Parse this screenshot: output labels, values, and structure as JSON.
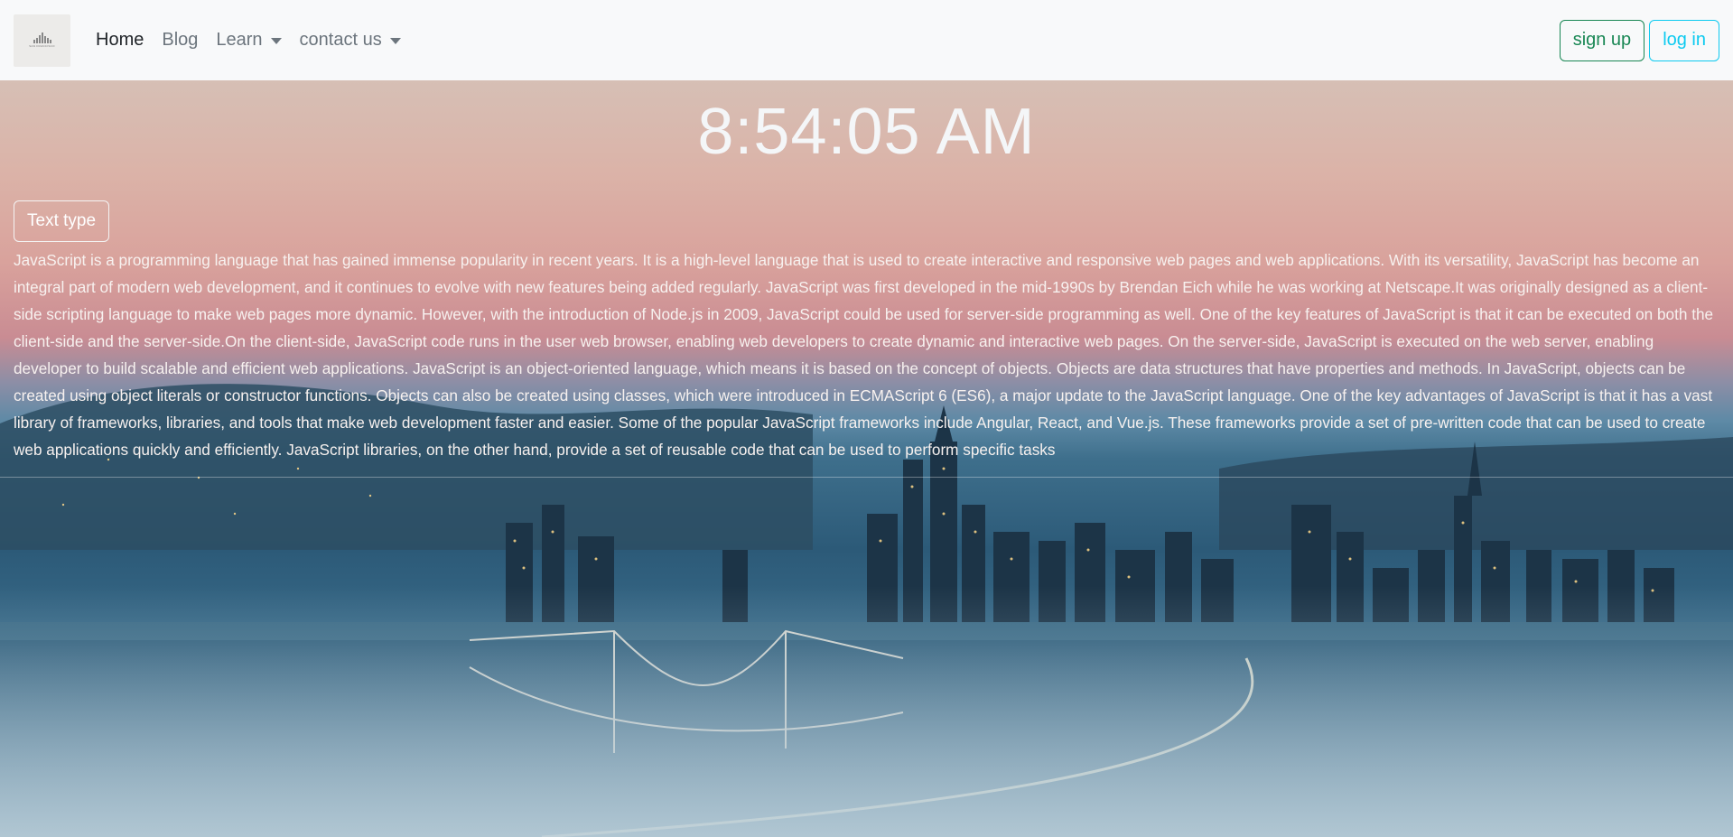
{
  "navbar": {
    "logo_text": "SAN FRANCISCO",
    "links": [
      {
        "label": "Home",
        "active": true,
        "dropdown": false
      },
      {
        "label": "Blog",
        "active": false,
        "dropdown": false
      },
      {
        "label": "Learn",
        "active": false,
        "dropdown": true
      },
      {
        "label": "contact us",
        "active": false,
        "dropdown": true
      }
    ],
    "signup_label": "sign up",
    "login_label": "log in"
  },
  "hero": {
    "clock": "8:54:05 AM",
    "text_type_label": "Text type",
    "paragraph": "JavaScript is a programming language that has gained immense popularity in recent years. It is a high-level language that is used to create interactive and responsive web pages and web applications. With its versatility, JavaScript has become an integral part of modern web development, and it continues to evolve with new features being added regularly. JavaScript was first developed in the mid-1990s by Brendan Eich while he was working at Netscape.It was originally designed as a client-side scripting language to make web pages more dynamic. However, with the introduction of Node.js in 2009, JavaScript could be used for server-side programming as well. One of the key features of JavaScript is that it can be executed on both the client-side and the server-side.On the client-side, JavaScript code runs in the user web browser, enabling web developers to create dynamic and interactive web pages. On the server-side, JavaScript is executed on the web server, enabling developer to build scalable and efficient web applications. JavaScript is an object-oriented language, which means it is based on the concept of objects. Objects are data structures that have properties and methods. In JavaScript, objects can be created using object literals or constructor functions. Objects can also be created using classes, which were introduced in ECMAScript 6 (ES6), a major update to the JavaScript language. One of the key advantages of JavaScript is that it has a vast library of frameworks, libraries, and tools that make web development faster and easier. Some of the popular JavaScript frameworks include Angular, React, and Vue.js. These frameworks provide a set of pre-written code that can be used to create web applications quickly and efficiently. JavaScript libraries, on the other hand, provide a set of reusable code that can be used to perform specific tasks"
  },
  "colors": {
    "navbar_bg": "#f8f9fa",
    "signup": "#198754",
    "login": "#0dcaf0",
    "text_light": "#ffffff"
  },
  "icons": [
    "logo-icon",
    "caret-down-icon"
  ]
}
